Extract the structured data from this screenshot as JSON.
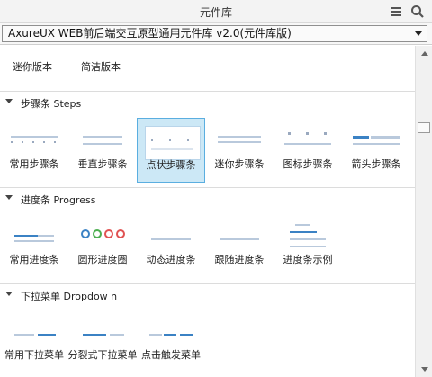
{
  "window": {
    "title": "元件库",
    "menu_icon": "hamburger-menu-icon",
    "search_icon": "search-icon"
  },
  "library_select": {
    "value": "AxureUX WEB前后端交互原型通用元件库 v2.0(元件库版)"
  },
  "legacy_items": [
    "迷你版本",
    "简洁版本"
  ],
  "sections": [
    {
      "title": "步骤条 Steps",
      "items": [
        "常用步骤条",
        "垂直步骤条",
        "点状步骤条",
        "迷你步骤条",
        "图标步骤条",
        "箭头步骤条"
      ],
      "selected_index": 2
    },
    {
      "title": "进度条 Progress",
      "items": [
        "常用进度条",
        "圆形进度圈",
        "动态进度条",
        "跟随进度条",
        "进度条示例"
      ]
    },
    {
      "title": "下拉菜单 Dropdow n",
      "items": [
        "常用下拉菜单",
        "分裂式下拉菜单",
        "点击触发菜单"
      ]
    }
  ],
  "colors": {
    "selection_bg": "#cce8f6",
    "selection_border": "#5aaee0",
    "accent": "#3b82c4"
  }
}
